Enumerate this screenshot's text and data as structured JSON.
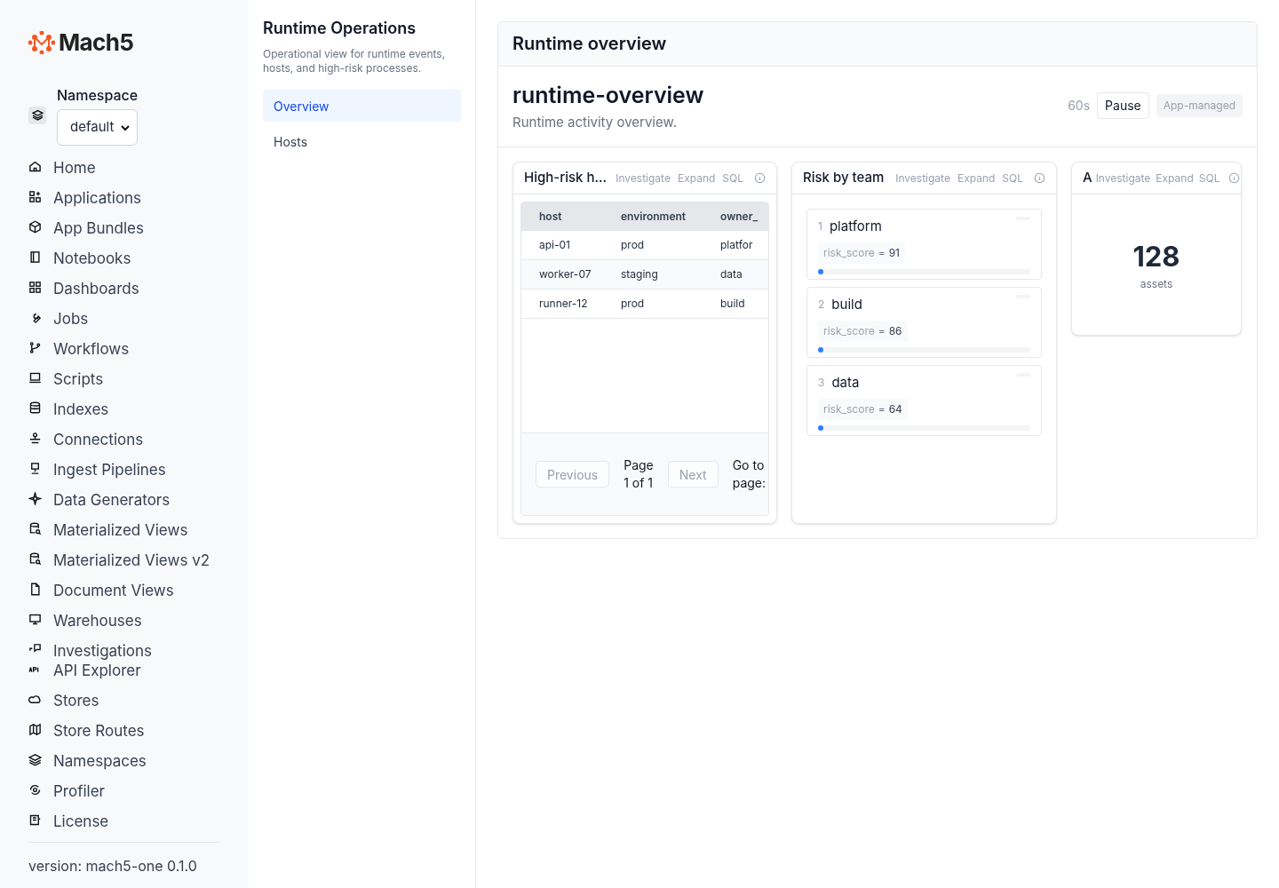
{
  "brand": "Mach5",
  "namespace": {
    "label": "Namespace",
    "value": "default"
  },
  "nav": [
    {
      "label": "Home"
    },
    {
      "label": "Applications"
    },
    {
      "label": "App Bundles"
    },
    {
      "label": "Notebooks"
    },
    {
      "label": "Dashboards"
    },
    {
      "label": "Jobs"
    },
    {
      "label": "Workflows"
    },
    {
      "label": "Scripts"
    },
    {
      "label": "Indexes"
    },
    {
      "label": "Connections"
    },
    {
      "label": "Ingest Pipelines"
    },
    {
      "label": "Data Generators"
    },
    {
      "label": "Materialized Views"
    },
    {
      "label": "Materialized Views v2"
    },
    {
      "label": "Document Views"
    },
    {
      "label": "Warehouses"
    },
    {
      "label": "Investigations"
    },
    {
      "label": "API Explorer"
    },
    {
      "label": "Stores"
    },
    {
      "label": "Store Routes"
    },
    {
      "label": "Namespaces"
    },
    {
      "label": "Profiler"
    },
    {
      "label": "License"
    }
  ],
  "version": "version: mach5-one 0.1.0",
  "section": {
    "title": "Runtime Operations",
    "description": "Operational view for runtime events, hosts, and high-risk processes.",
    "items": [
      {
        "label": "Overview",
        "selected": true
      },
      {
        "label": "Hosts",
        "selected": false
      }
    ]
  },
  "panel": {
    "title": "Runtime overview",
    "name": "runtime-overview",
    "subtitle": "Runtime activity overview.",
    "interval": "60s",
    "pause": "Pause",
    "badge": "App-managed"
  },
  "widgets": [
    {
      "kind": "table",
      "title": "High-risk h...",
      "actions": [
        "Investigate",
        "Expand",
        "SQL"
      ],
      "columns": [
        "host",
        "environment",
        "owner_"
      ],
      "rows": [
        [
          "api-01",
          "prod",
          "platfor"
        ],
        [
          "worker-07",
          "staging",
          "data"
        ],
        [
          "runner-12",
          "prod",
          "build"
        ]
      ],
      "pagination": {
        "previous": "Previous",
        "page": "Page 1 of 1",
        "next": "Next",
        "goto": "Go to page:"
      }
    },
    {
      "kind": "ranking",
      "title": "Risk by team",
      "actions": [
        "Investigate",
        "Expand",
        "SQL"
      ],
      "items": [
        {
          "rank": "1",
          "name": "platform",
          "metric": "risk_score",
          "op": "=",
          "value": "91",
          "level": 0.01
        },
        {
          "rank": "2",
          "name": "build",
          "metric": "risk_score",
          "op": "=",
          "value": "86",
          "level": 0.01
        },
        {
          "rank": "3",
          "name": "data",
          "metric": "risk_score",
          "op": "=",
          "value": "64",
          "level": 0.01
        }
      ]
    },
    {
      "kind": "stat",
      "title": "A",
      "actions": [
        "Investigate",
        "Expand",
        "SQL"
      ],
      "value": "128",
      "caption": "assets"
    }
  ]
}
